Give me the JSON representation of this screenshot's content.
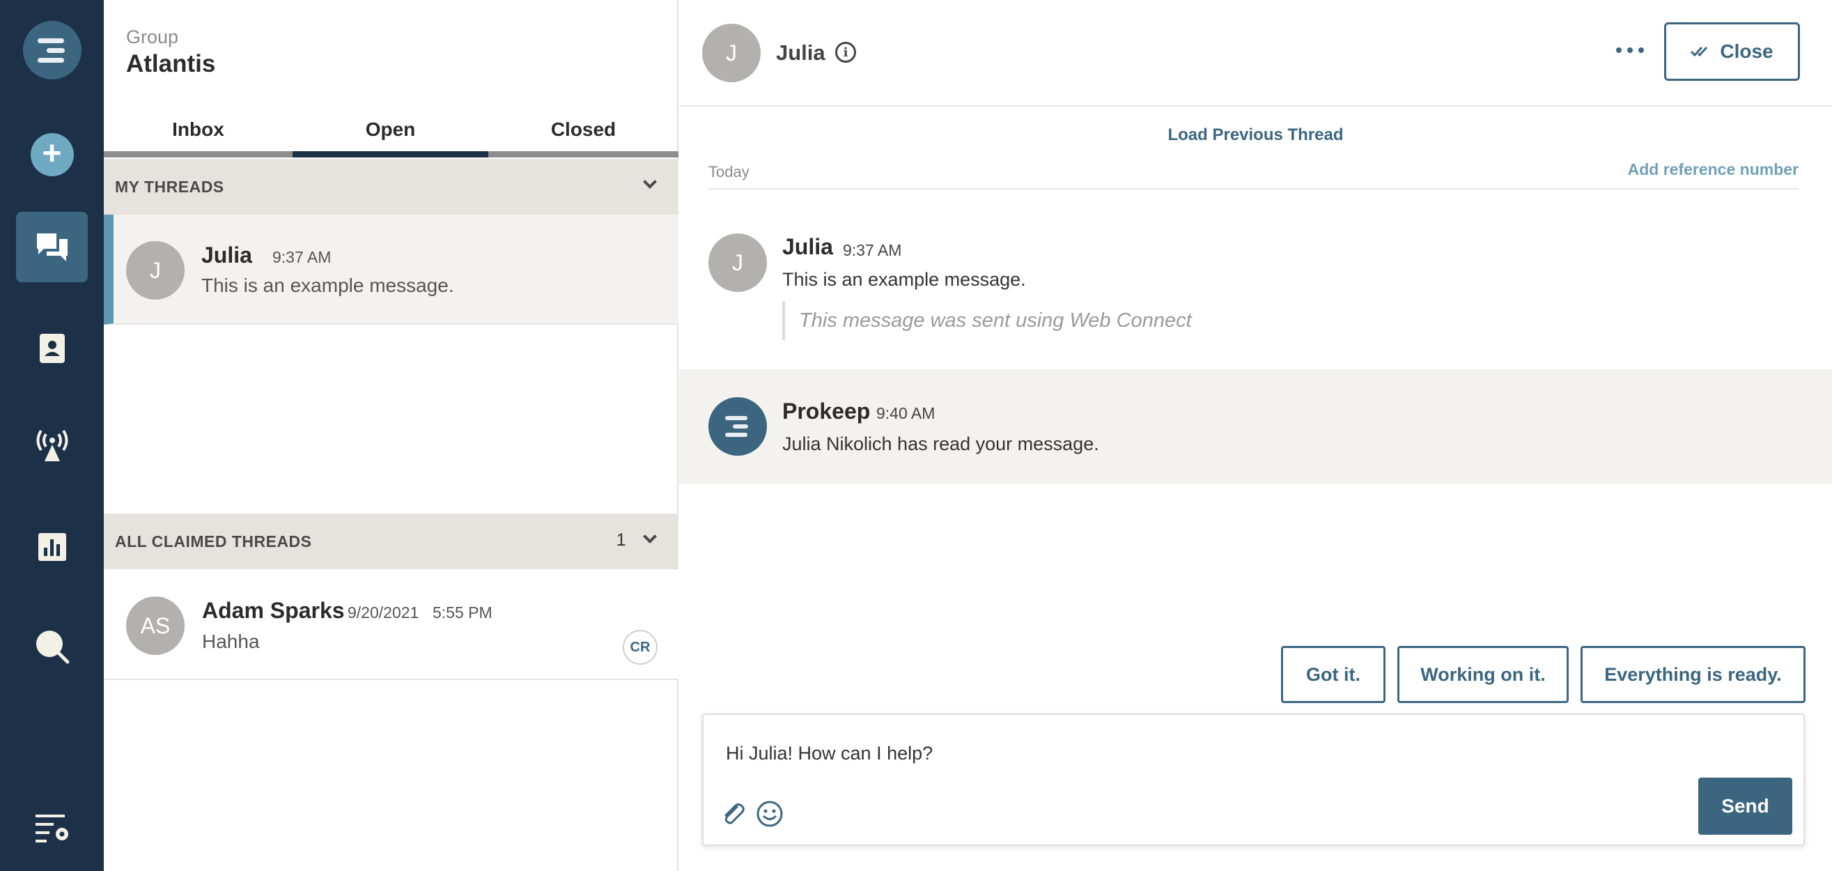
{
  "nav": {
    "items": [
      {
        "icon": "logo-icon"
      },
      {
        "icon": "plus-icon"
      },
      {
        "icon": "chat-icon"
      },
      {
        "icon": "contacts-icon"
      },
      {
        "icon": "broadcast-icon"
      },
      {
        "icon": "reports-icon"
      },
      {
        "icon": "search-icon"
      },
      {
        "icon": "settings-icon"
      }
    ]
  },
  "group": {
    "label": "Group",
    "name": "Atlantis"
  },
  "tabs": [
    {
      "label": "Inbox"
    },
    {
      "label": "Open",
      "active": true
    },
    {
      "label": "Closed"
    }
  ],
  "my_threads": {
    "header": "MY THREADS",
    "threads": [
      {
        "initial": "J",
        "name": "Julia",
        "time": "9:37 AM",
        "preview": "This is an example message."
      }
    ]
  },
  "claimed_threads": {
    "header": "ALL CLAIMED THREADS",
    "count": "1",
    "threads": [
      {
        "initial": "AS",
        "name": "Adam Sparks",
        "date": "9/20/2021",
        "time": "5:55 PM",
        "preview": "Hahha",
        "badge": "CR"
      }
    ]
  },
  "conversation": {
    "contact_initial": "J",
    "contact_name": "Julia",
    "close_label": "Close",
    "load_previous": "Load Previous Thread",
    "day_label": "Today",
    "add_reference": "Add reference number",
    "messages": [
      {
        "initial": "J",
        "sender": "Julia",
        "time": "9:37 AM",
        "text": "This is an example message.",
        "note": "This message was sent using Web Connect"
      },
      {
        "sender": "Prokeep",
        "time": "9:40 AM",
        "text": "Julia Nikolich has read your message."
      }
    ],
    "quick_replies": [
      "Got it.",
      "Working on it.",
      "Everything is ready."
    ],
    "composer_text": "Hi Julia! How can I help?",
    "send_label": "Send"
  },
  "colors": {
    "rail": "#1c3048",
    "accent": "#3c6680",
    "accent_light": "#6fa9c2",
    "row_selected": "#f4f2ee",
    "section_header": "#e6e3df"
  }
}
